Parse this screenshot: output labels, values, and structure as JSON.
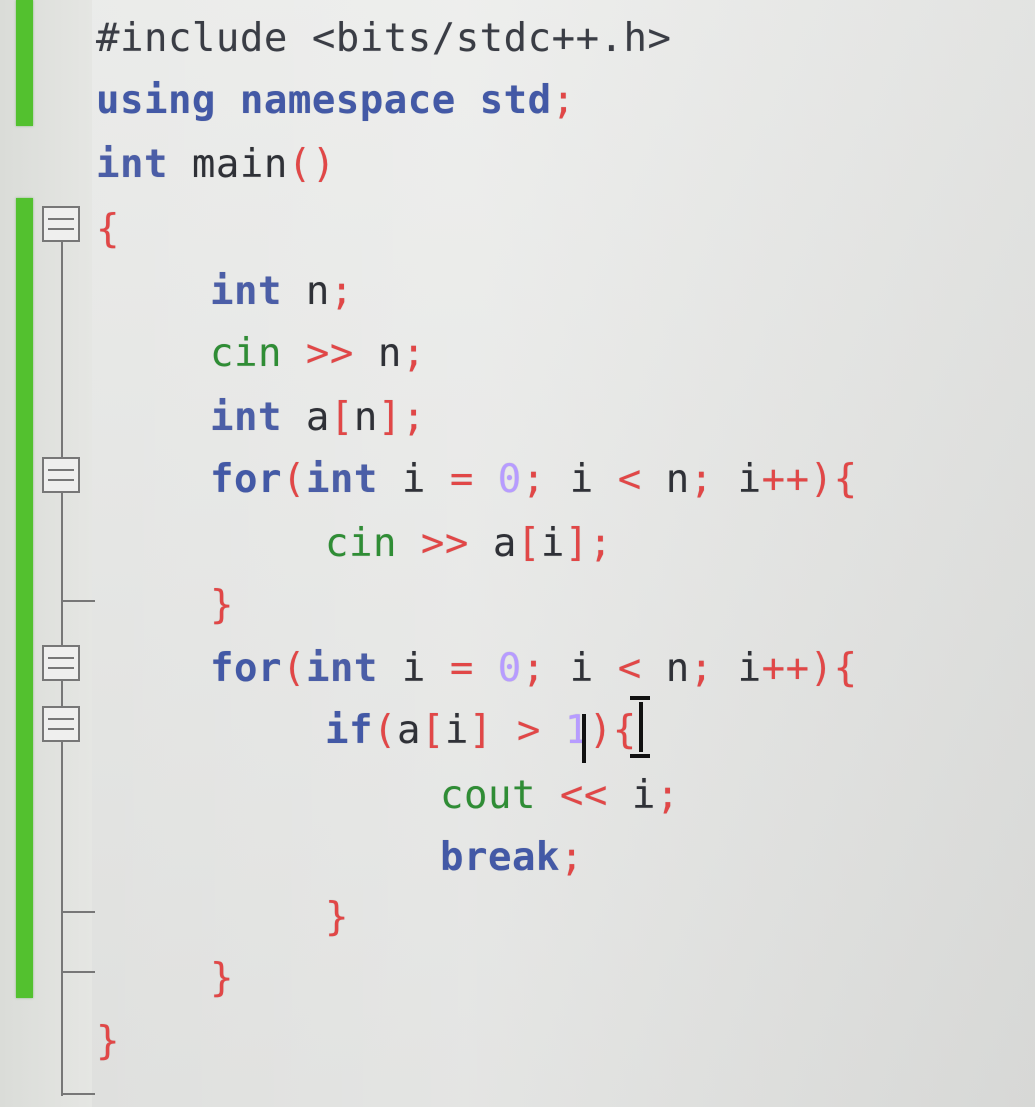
{
  "code_lines": [
    {
      "tokens": [
        {
          "text": "#include <bits/stdc++.h>",
          "kind": "preprocessor"
        }
      ]
    },
    {
      "tokens": [
        {
          "text": "using namespace std",
          "kind": "keyword"
        },
        {
          "text": ";",
          "kind": "punct"
        }
      ]
    },
    {
      "tokens": [
        {
          "text": "int ",
          "kind": "type"
        },
        {
          "text": "main",
          "kind": "identifier"
        },
        {
          "text": "()",
          "kind": "punct"
        }
      ]
    },
    {
      "tokens": [
        {
          "text": "{",
          "kind": "punct"
        }
      ]
    },
    {
      "tokens": [
        {
          "text": "int ",
          "kind": "type"
        },
        {
          "text": "n",
          "kind": "identifier"
        },
        {
          "text": ";",
          "kind": "punct"
        }
      ]
    },
    {
      "tokens": [
        {
          "text": "cin ",
          "kind": "stream"
        },
        {
          "text": ">>",
          "kind": "punct"
        },
        {
          "text": " n",
          "kind": "identifier"
        },
        {
          "text": ";",
          "kind": "punct"
        }
      ]
    },
    {
      "tokens": [
        {
          "text": "int ",
          "kind": "type"
        },
        {
          "text": "a",
          "kind": "identifier"
        },
        {
          "text": "[",
          "kind": "punct"
        },
        {
          "text": "n",
          "kind": "identifier"
        },
        {
          "text": "];",
          "kind": "punct"
        }
      ]
    },
    {
      "tokens": [
        {
          "text": "for",
          "kind": "keyword"
        },
        {
          "text": "(",
          "kind": "punct"
        },
        {
          "text": "int ",
          "kind": "type"
        },
        {
          "text": "i ",
          "kind": "identifier"
        },
        {
          "text": "= ",
          "kind": "punct"
        },
        {
          "text": "0",
          "kind": "number"
        },
        {
          "text": "; ",
          "kind": "punct"
        },
        {
          "text": "i ",
          "kind": "identifier"
        },
        {
          "text": "< ",
          "kind": "punct"
        },
        {
          "text": "n",
          "kind": "identifier"
        },
        {
          "text": "; ",
          "kind": "punct"
        },
        {
          "text": "i",
          "kind": "identifier"
        },
        {
          "text": "++){",
          "kind": "punct"
        }
      ]
    },
    {
      "tokens": [
        {
          "text": "cin ",
          "kind": "stream"
        },
        {
          "text": ">>",
          "kind": "punct"
        },
        {
          "text": " a",
          "kind": "identifier"
        },
        {
          "text": "[",
          "kind": "punct"
        },
        {
          "text": "i",
          "kind": "identifier"
        },
        {
          "text": "];",
          "kind": "punct"
        }
      ]
    },
    {
      "tokens": [
        {
          "text": "}",
          "kind": "punct"
        }
      ]
    },
    {
      "tokens": [
        {
          "text": "for",
          "kind": "keyword"
        },
        {
          "text": "(",
          "kind": "punct"
        },
        {
          "text": "int ",
          "kind": "type"
        },
        {
          "text": "i ",
          "kind": "identifier"
        },
        {
          "text": "= ",
          "kind": "punct"
        },
        {
          "text": "0",
          "kind": "number"
        },
        {
          "text": "; ",
          "kind": "punct"
        },
        {
          "text": "i ",
          "kind": "identifier"
        },
        {
          "text": "< ",
          "kind": "punct"
        },
        {
          "text": "n",
          "kind": "identifier"
        },
        {
          "text": "; ",
          "kind": "punct"
        },
        {
          "text": "i",
          "kind": "identifier"
        },
        {
          "text": "++){",
          "kind": "punct"
        }
      ]
    },
    {
      "tokens": [
        {
          "text": "if",
          "kind": "keyword"
        },
        {
          "text": "(",
          "kind": "punct"
        },
        {
          "text": "a",
          "kind": "identifier"
        },
        {
          "text": "[",
          "kind": "punct"
        },
        {
          "text": "i",
          "kind": "identifier"
        },
        {
          "text": "] ",
          "kind": "punct"
        },
        {
          "text": ">",
          "kind": "punct"
        },
        {
          "text": " 1",
          "kind": "number"
        },
        {
          "text": "){",
          "kind": "punct"
        }
      ]
    },
    {
      "tokens": [
        {
          "text": "cout ",
          "kind": "stream"
        },
        {
          "text": "<<",
          "kind": "punct"
        },
        {
          "text": " i",
          "kind": "identifier"
        },
        {
          "text": ";",
          "kind": "punct"
        }
      ]
    },
    {
      "tokens": [
        {
          "text": "break",
          "kind": "keyword"
        },
        {
          "text": ";",
          "kind": "punct"
        }
      ]
    },
    {
      "tokens": [
        {
          "text": "}",
          "kind": "punct"
        }
      ]
    },
    {
      "tokens": [
        {
          "text": "}",
          "kind": "punct"
        }
      ]
    },
    {
      "tokens": [
        {
          "text": "}",
          "kind": "punct"
        }
      ]
    }
  ],
  "colors": {
    "background": "#e7e8e6",
    "change_marker": "#53c12f",
    "fold_marker": "#777777",
    "preprocessor": "#3a3d45",
    "keyword": "#4359a6",
    "type": "#4b5ea7",
    "identifier": "#2f3137",
    "stream": "#2f8d35",
    "punct": "#e14747",
    "number": "#b79cff",
    "caret": "#111111"
  },
  "icons": {
    "change_marker": "change-marker-icon",
    "fold_marker": "fold-marker-icon",
    "text_cursor": "text-cursor-icon",
    "caret": "caret-icon"
  }
}
